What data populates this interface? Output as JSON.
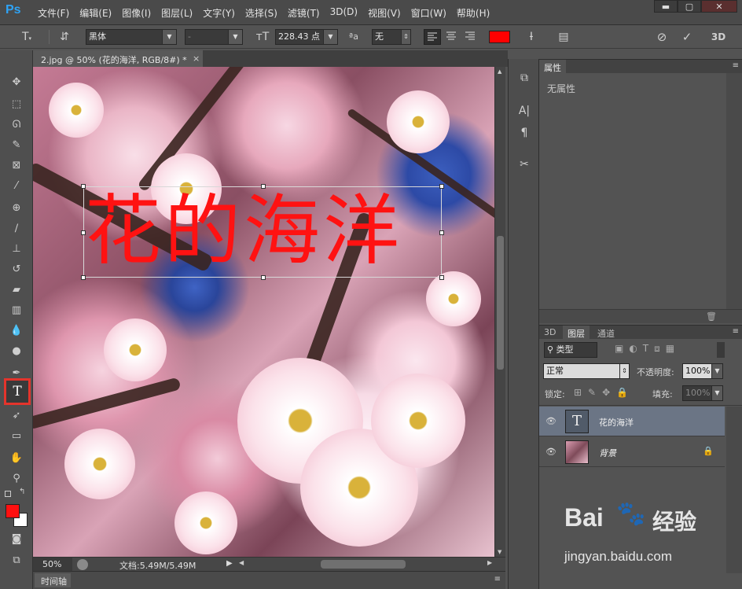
{
  "app": {
    "logo": "Ps"
  },
  "menu": [
    "文件(F)",
    "编辑(E)",
    "图像(I)",
    "图层(L)",
    "文字(Y)",
    "选择(S)",
    "滤镜(T)",
    "3D(D)",
    "视图(V)",
    "窗口(W)",
    "帮助(H)"
  ],
  "window_controls": {
    "minimize": "▬",
    "maximize": "▢",
    "close": "✕"
  },
  "options": {
    "font_family": "黑体",
    "font_style": "-",
    "font_size": "228.43 点",
    "aa_label": "ªa",
    "antialias": "无",
    "text_color": "#ff0000"
  },
  "document": {
    "tab_title": "2.jpg @ 50% (花的海洋, RGB/8#) *",
    "close": "×",
    "canvas_text": "花的海洋"
  },
  "status": {
    "zoom": "50%",
    "doc_info": "文档:5.49M/5.49M"
  },
  "timeline": {
    "label": "时间轴"
  },
  "properties": {
    "tab": "属性",
    "empty_text": "无属性"
  },
  "layers_panel": {
    "tabs": [
      "3D",
      "图层",
      "通道"
    ],
    "filter_label": "类型",
    "blend_mode": "正常",
    "opacity_label": "不透明度:",
    "opacity_value": "100%",
    "lock_label": "锁定:",
    "fill_label": "填充:",
    "fill_value": "100%",
    "layers": [
      {
        "name": "花的海洋",
        "thumb_glyph": "T",
        "selected": true
      },
      {
        "name": "背景",
        "selected": false
      }
    ]
  },
  "colors": {
    "foreground": "#ff1010",
    "background": "#ffffff",
    "accent": "#e4342c"
  },
  "watermark": {
    "brand_a": "Bai",
    "brand_b": "经验",
    "url": "jingyan.baidu.com"
  }
}
